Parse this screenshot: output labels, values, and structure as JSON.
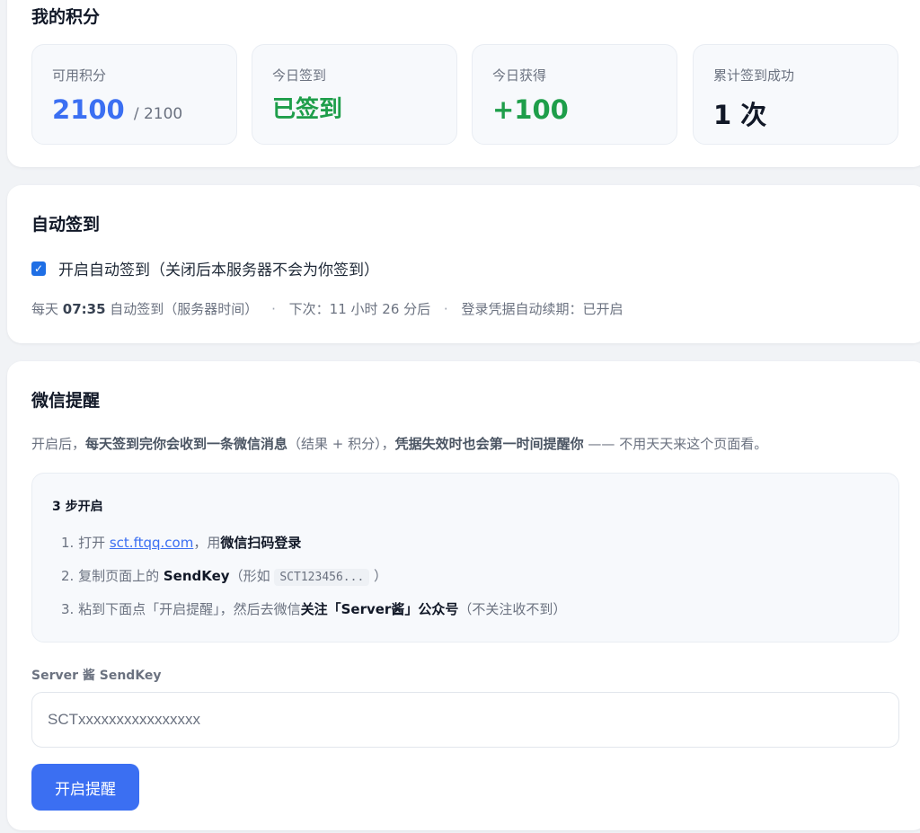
{
  "points": {
    "title": "我的积分",
    "available": {
      "label": "可用积分",
      "value": "2100",
      "total": "/ 2100"
    },
    "today_checkin": {
      "label": "今日签到",
      "value": "已签到"
    },
    "today_earned": {
      "label": "今日获得",
      "value": "+100"
    },
    "total_success": {
      "label": "累计签到成功",
      "value": "1 次"
    }
  },
  "auto_checkin": {
    "title": "自动签到",
    "checkbox_label": "开启自动签到（关闭后本服务器不会为你签到）",
    "checked": true,
    "meta_prefix": "每天 ",
    "meta_time": "07:35",
    "meta_suffix": " 自动签到（服务器时间）",
    "next_run": "下次：11 小时 26 分后",
    "renew": "登录凭据自动续期：已开启"
  },
  "wechat": {
    "title": "微信提醒",
    "desc_part1": "开启后，",
    "desc_bold1": "每天签到完你会收到一条微信消息",
    "desc_part2": "（结果 + 积分），",
    "desc_bold2": "凭据失效时也会第一时间提醒你",
    "desc_part3": " —— 不用天天来这个页面看。",
    "steps_title": "3 步开启",
    "step1_prefix": "1. 打开 ",
    "step1_link": "sct.ftqq.com",
    "step1_mid": "，用",
    "step1_bold": "微信扫码登录",
    "step2_prefix": "2. 复制页面上的 ",
    "step2_bold": "SendKey",
    "step2_mid": "（形如 ",
    "step2_code": "SCT123456...",
    "step2_suffix": " ）",
    "step3_prefix": "3. 粘到下面点「开启提醒」，然后去微信",
    "step3_bold": "关注「Server酱」公众号",
    "step3_suffix": "（不关注收不到）",
    "field_label": "Server 酱 SendKey",
    "input_placeholder": "SCTxxxxxxxxxxxxxxxx",
    "button_label": "开启提醒"
  },
  "colors": {
    "accent": "#3b6ff2",
    "success": "#1e9e4a"
  }
}
